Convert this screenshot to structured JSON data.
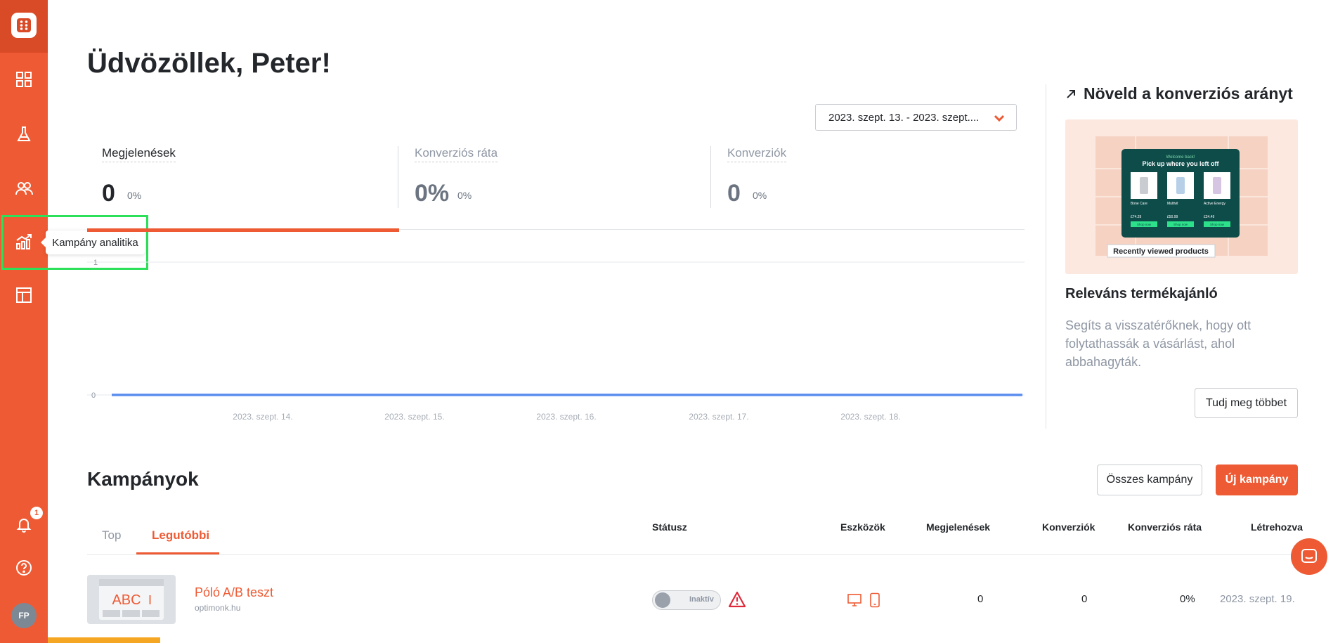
{
  "sidebar": {
    "nav_items": [
      {
        "name": "dashboard",
        "icon": "grid-icon"
      },
      {
        "name": "experiments",
        "icon": "flask-icon"
      },
      {
        "name": "audience",
        "icon": "users-icon"
      },
      {
        "name": "campaign-analytics",
        "icon": "chart-icon"
      },
      {
        "name": "templates",
        "icon": "layout-icon"
      }
    ],
    "notification_count": "1",
    "avatar_initials": "FP",
    "tooltip": "Kampány analitika"
  },
  "greeting": "Üdvözöllek, Peter!",
  "date_range": "2023. szept. 13. - 2023. szept....",
  "kpis": [
    {
      "label": "Megjelenések",
      "value": "0",
      "pct": "0%"
    },
    {
      "label": "Konverziós ráta",
      "value": "0%",
      "pct": "0%"
    },
    {
      "label": "Konverziók",
      "value": "0",
      "pct": "0%"
    }
  ],
  "chart": {
    "y_ticks": [
      "1",
      "0"
    ],
    "x_labels": [
      "2023. szept. 14.",
      "2023. szept. 15.",
      "2023. szept. 16.",
      "2023. szept. 17.",
      "2023. szept. 18."
    ]
  },
  "right_panel": {
    "title": "Növeld a konverziós arányt",
    "image": {
      "popup_small": "Welcome back!",
      "popup_title": "Pick up where you left off",
      "products": [
        {
          "name": "Bone Care",
          "price": "£74.29",
          "cta": "Shop now"
        },
        {
          "name": "Multivit",
          "price": "£50.99",
          "cta": "Shop now"
        },
        {
          "name": "Active Energy",
          "price": "£24.49",
          "cta": "Shop now"
        }
      ],
      "badge": "Recently viewed products"
    },
    "heading": "Releváns termékajánló",
    "text": "Segíts a visszatérőknek, hogy ott folytathassák a vásárlást, ahol abbahagyták.",
    "button": "Tudj meg többet"
  },
  "campaigns": {
    "title": "Kampányok",
    "all_button": "Összes kampány",
    "new_button": "Új kampány",
    "tabs": [
      "Top",
      "Legutóbbi"
    ],
    "columns": [
      "Státusz",
      "Eszközök",
      "Megjelenések",
      "Konverziók",
      "Konverziós ráta",
      "Létrehozva"
    ],
    "rows": [
      {
        "thumb_text": "ABC",
        "name": "Póló A/B teszt",
        "domain": "optimonk.hu",
        "status": "Inaktív",
        "impressions": "0",
        "conversions": "0",
        "conversion_rate": "0%",
        "created": "2023. szept. 19."
      }
    ]
  },
  "colors": {
    "accent": "#ee5a33",
    "line": "#5b8def",
    "highlight": "#2de05a"
  }
}
